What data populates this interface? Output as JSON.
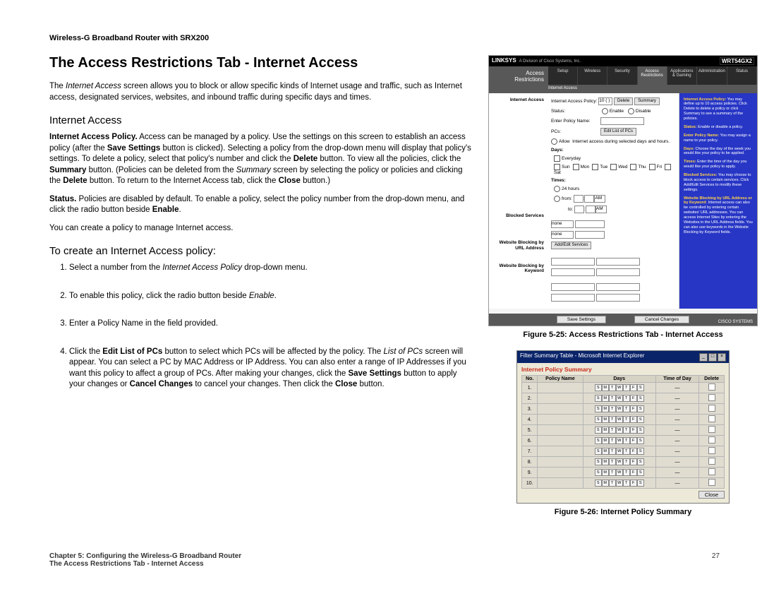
{
  "doc_header": "Wireless-G Broadband Router with SRX200",
  "page_title": "The Access Restrictions Tab - Internet Access",
  "intro_html": "The <span class='i'>Internet Access</span> screen allows you to block or allow specific kinds of Internet usage and traffic, such as Internet access, designated services, websites, and inbound traffic during specific days and times.",
  "section_internet_access": "Internet Access",
  "p_policy_html": "<span class='b'>Internet Access Policy.</span> Access can be managed by a policy. Use the settings on this screen to establish an access policy (after the <span class='b'>Save Settings</span> button is clicked). Selecting a policy from the drop-down menu will display that policy's settings. To delete a policy, select that policy's number and click the <span class='b'>Delete</span> button. To view all the policies, click the <span class='b'>Summary</span> button. (Policies can be deleted from the <span class='i'>Summary</span> screen by selecting the policy or policies and clicking the <span class='b'>Delete</span> button. To return to the Internet Access tab, click the <span class='b'>Close</span> button.)",
  "p_status_html": "<span class='b'>Status.</span> Policies are disabled by default. To enable a policy, select the policy number from the drop-down menu, and click the radio button beside <span class='b'>Enable</span>.",
  "p_create": "You can create a policy to manage Internet access.",
  "section_howto": "To create an Internet Access policy:",
  "steps_html": [
    "Select a number from the <span class='i'>Internet Access Policy</span> drop-down menu.",
    "To enable this policy, click the radio button beside <span class='i'>Enable</span>.",
    "Enter a Policy Name in the field provided.",
    "Click the <span class='b'>Edit List of PCs</span> button to select which PCs will be affected by the policy. The <span class='i'>List of PCs</span> screen will appear. You can select a PC by MAC Address or IP Address. You can also enter a range of IP Addresses if you want this policy to affect a group of PCs. After making your changes, click the <span class='b'>Save Settings</span> button to apply your changes or <span class='b'>Cancel Changes</span> to cancel your changes. Then click the <span class='b'>Close</span> button."
  ],
  "fig25_caption": "Figure 5-25: Access Restrictions Tab - Internet Access",
  "fig26_caption": "Figure 5-26: Internet Policy Summary",
  "footer": {
    "chapter": "Chapter 5: Configuring the Wireless-G Broadband Router",
    "page_num": "27",
    "section": "The Access Restrictions Tab - Internet Access"
  },
  "fig25": {
    "brand": "LINKSYS",
    "tagline": "A Division of Cisco Systems, Inc.",
    "model": "WRT54GX2",
    "navleft": "Access\nRestrictions",
    "tabs": [
      "Setup",
      "Wireless",
      "Security",
      "Access Restrictions",
      "Applications & Gaming",
      "Administration",
      "Status"
    ],
    "active_tab_index": 3,
    "subnav": "Internet Access",
    "side_labels": [
      "Internet Access",
      "",
      "",
      "",
      "",
      "Blocked Services",
      "Website Blocking by URL Address",
      "Website Blocking by Keyword"
    ],
    "form": {
      "policy_label": "Internet Access Policy:",
      "policy_value": "10 ( )",
      "delete_btn": "Delete",
      "summary_btn": "Summary",
      "status_label": "Status:",
      "enable": "Enable",
      "disable": "Disable",
      "policy_name_label": "Enter Policy Name:",
      "pcs_label": "PCs:",
      "edit_list_btn": "Edit List of PCs",
      "allow_text": "Internet access during selected days and hours.",
      "days_label": "Days:",
      "days": [
        "Everyday",
        "Sun",
        "Mon",
        "Tue",
        "Wed",
        "Thu",
        "Fri",
        "Sat"
      ],
      "times_label": "Times:",
      "time_24": "24 hours",
      "time_from": "from:",
      "time_to": "to:",
      "am": "AM",
      "none": "none",
      "addedit_btn": "Add/Edit Services",
      "save_btn": "Save Settings",
      "cancel_btn": "Cancel Changes",
      "corner": "CISCO SYSTEMS"
    },
    "help": [
      {
        "t": "Internet Access Policy:",
        "d": "You may define up to 10 access policies. Click Delete to delete a policy or click Summary to see a summary of the policies."
      },
      {
        "t": "Status:",
        "d": "Enable or disable a policy."
      },
      {
        "t": "Enter Policy Name:",
        "d": "You may assign a name to your policy."
      },
      {
        "t": "Days:",
        "d": "Choose the day of the week you would like your policy to be applied."
      },
      {
        "t": "Times:",
        "d": "Enter the time of the day you would like your policy to apply."
      },
      {
        "t": "Blocked Services:",
        "d": "You may choose to block access to certain services. Click Add/Edit Services to modify these settings."
      },
      {
        "t": "Website Blocking by URL Address or by Keyword:",
        "d": "Internet access can also be controlled by entering certain websites' URL addresses. You can access Internet Sites by entering the Websites in the URL Address fields. You can also use keywords in the Website Blocking by Keyword fields."
      }
    ]
  },
  "fig26": {
    "window_title": "Filter Summary Table - Microsoft Internet Explorer",
    "heading": "Internet Policy Summary",
    "cols": [
      "No.",
      "Policy Name",
      "Days",
      "Time of Day",
      "Delete"
    ],
    "day_letters": [
      "S",
      "M",
      "T",
      "W",
      "T",
      "F",
      "S"
    ],
    "rows": [
      1,
      2,
      3,
      4,
      5,
      6,
      7,
      8,
      9,
      10
    ],
    "tod_placeholder": "—",
    "close_btn": "Close"
  }
}
